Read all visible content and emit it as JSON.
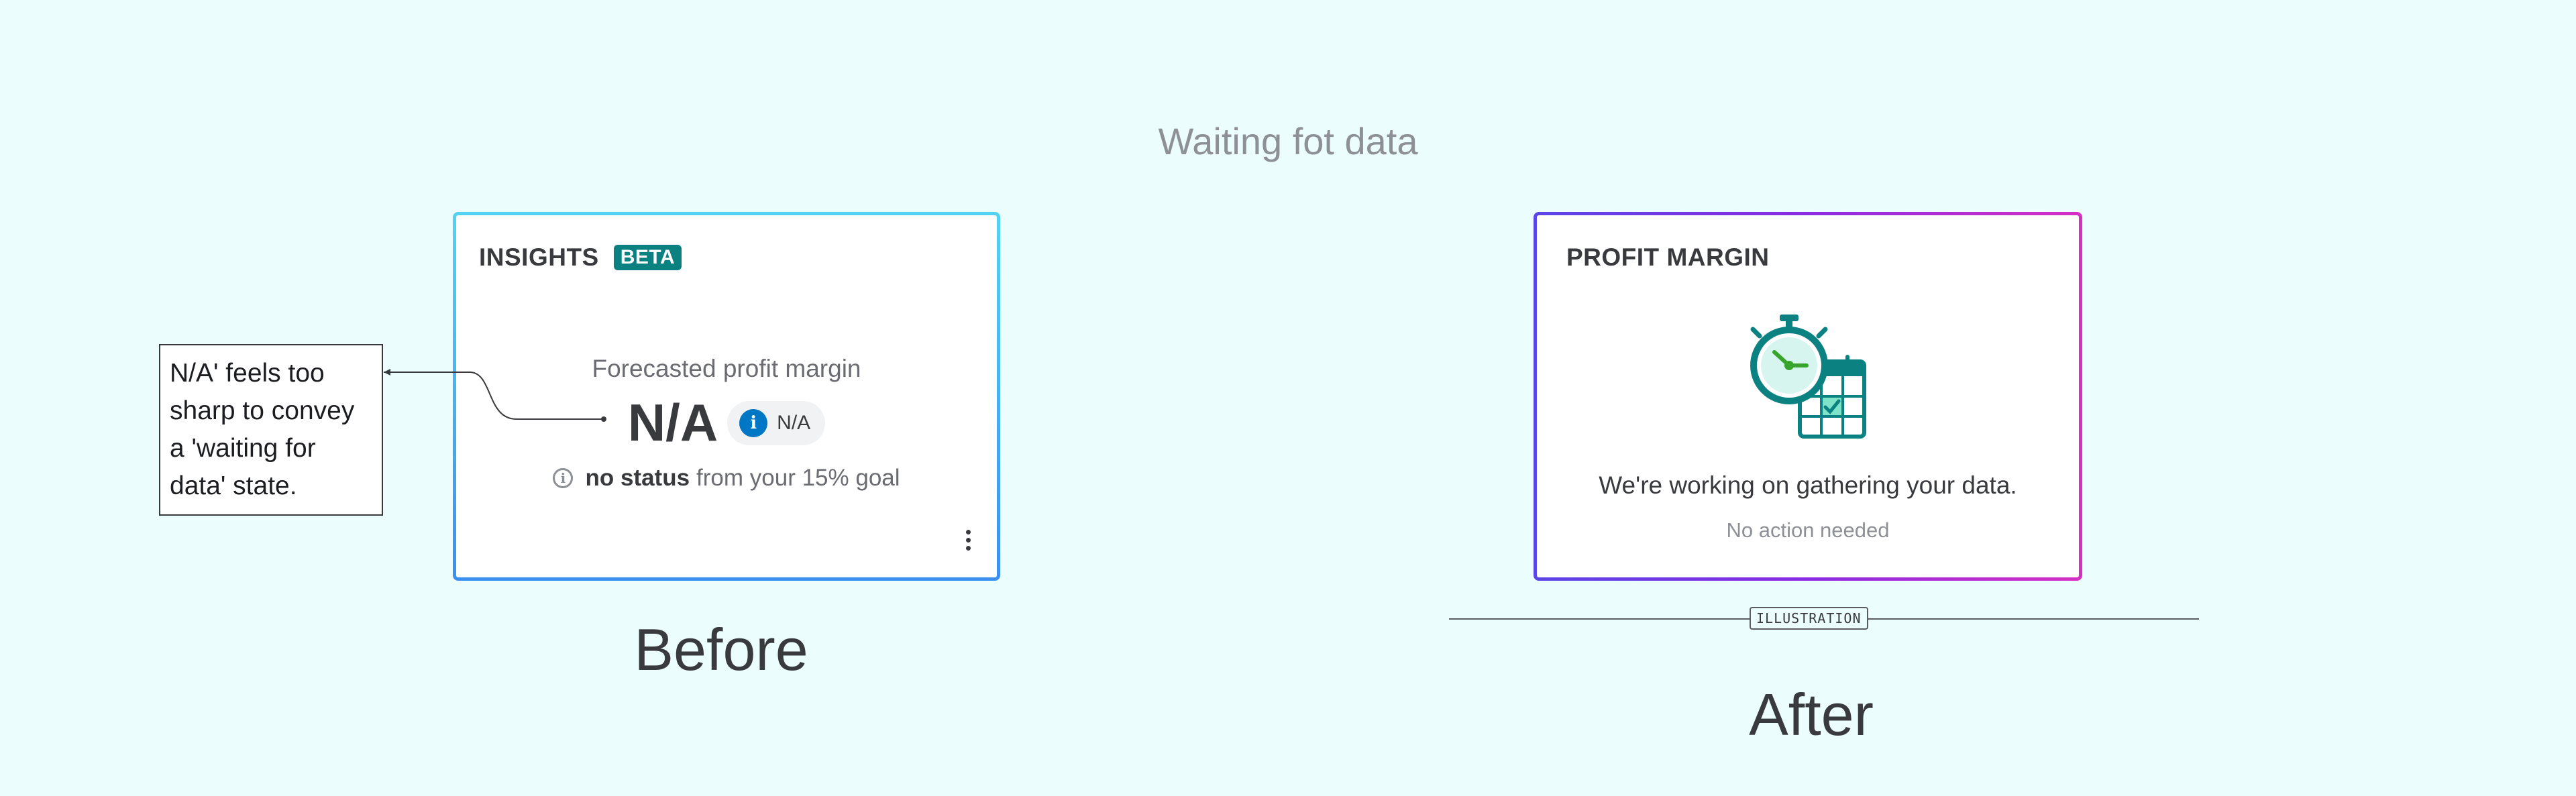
{
  "page": {
    "title": "Waiting fot data"
  },
  "before_card": {
    "title": "INSIGHTS",
    "badge": "BETA",
    "forecast_label": "Forecasted profit margin",
    "value": "N/A",
    "pill_icon": "info-icon",
    "pill_text": "N/A",
    "status_strong": "no status",
    "status_rest": "from your 15% goal",
    "menu_icon": "kebab-menu-icon",
    "border_colors": [
      "#53d3f2",
      "#3b8ff0"
    ],
    "badge_color": "#0b8281"
  },
  "after_card": {
    "title": "PROFIT MARGIN",
    "illustration": "stopwatch-calendar-icon",
    "message": "We're working on gathering your data.",
    "submessage": "No action needed",
    "border_colors": [
      "#5a45e6",
      "#8a2be2",
      "#d62fc4"
    ]
  },
  "annotation": {
    "text": "N/A' feels too sharp to convey a 'waiting for data' state."
  },
  "captions": {
    "before": "Before",
    "after": "After"
  },
  "divider": {
    "tag": "ILLUSTRATION"
  },
  "colors": {
    "background": "#ecfdfd",
    "accent_teal": "#0b8281",
    "info_blue": "#0077c5",
    "text_dark": "#393a3d",
    "text_muted": "#8d9096"
  }
}
